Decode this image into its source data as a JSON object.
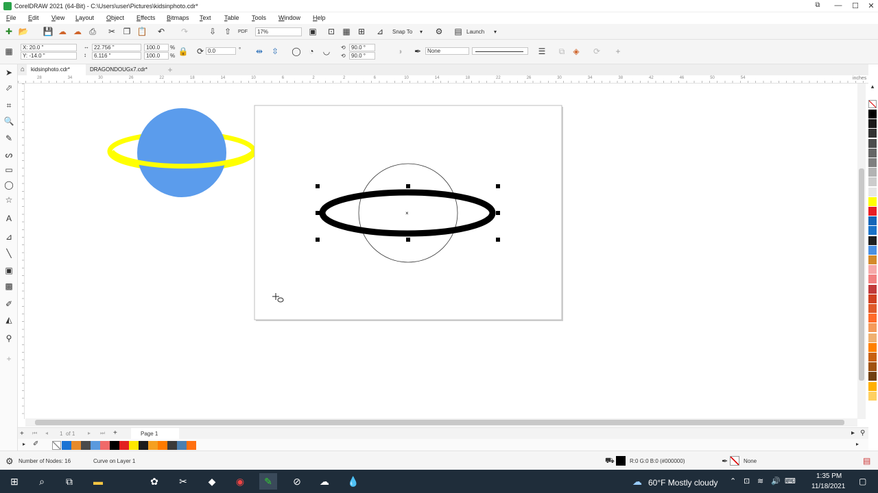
{
  "window": {
    "title": "CorelDRAW 2021 (64-Bit) - C:\\Users\\user\\Pictures\\kidsinphoto.cdr*",
    "minimize": "—",
    "maximize": "☐",
    "close": "✕"
  },
  "menu": [
    "File",
    "Edit",
    "View",
    "Layout",
    "Object",
    "Effects",
    "Bitmaps",
    "Text",
    "Table",
    "Tools",
    "Window",
    "Help"
  ],
  "standard_toolbar": {
    "zoom": "17%",
    "snap_to": "Snap To",
    "launch": "Launch"
  },
  "property_bar": {
    "x": "X: 20.0 \"",
    "y": "Y: -14.0 \"",
    "width": "22.756 \"",
    "height": "6.116 \"",
    "scale_w": "100.0",
    "scale_h": "100.0",
    "pct": "%",
    "rotation": "0.0",
    "angle1": "90.0 °",
    "angle2": "90.0 °",
    "outline_none": "None"
  },
  "tabs": [
    "kidsinphoto.cdr*",
    "DRAGONDOUGx7.cdr*"
  ],
  "ruler": {
    "top": [
      "28",
      "34",
      "30",
      "26",
      "22",
      "18",
      "14",
      "10",
      "6",
      "2",
      "2",
      "6",
      "10",
      "14",
      "18",
      "22",
      "26",
      "30",
      "34",
      "38",
      "42",
      "46",
      "50",
      "54"
    ],
    "unit": "inches"
  },
  "page_nav": {
    "current": "1",
    "of": "of 1",
    "page_tab": "Page 1"
  },
  "doc_palette": [
    "#1a73d4",
    "#e78a2b",
    "#4a4a4a",
    "#5a9ade",
    "#f06a6a",
    "#000000",
    "#e22020",
    "#ffe800",
    "#1c1c1c",
    "#f5a020",
    "#ff7b00",
    "#3a3a3a",
    "#4a7fb0",
    "#ff7010"
  ],
  "side_palette": [
    "#000000",
    "#1a1a1a",
    "#333333",
    "#4d4d4d",
    "#666666",
    "#808080",
    "#b3b3b3",
    "#cccccc",
    "#e6e6e6",
    "#ffff00",
    "#e81e25",
    "#1465b8",
    "#1a72c8",
    "#202020",
    "#4a90e2",
    "#d48a2a",
    "#f7a8a8",
    "#f28080",
    "#c23a3a",
    "#d04020",
    "#e05a2a",
    "#ff6b2a",
    "#f59a5a",
    "#f0b070",
    "#ff8000",
    "#c86010",
    "#a0520f",
    "#704010",
    "#ffb000",
    "#ffd060"
  ],
  "status": {
    "nodes": "Number of Nodes: 16",
    "layer": "Curve on Layer 1",
    "fill": "R:0 G:0 B:0 (#000000)",
    "outline": "None"
  },
  "taskbar": {
    "weather": "60°F  Mostly cloudy",
    "time": "1:35 PM",
    "date": "11/18/2021"
  },
  "colors": {
    "planet": "#5b9cec",
    "ring": "#ffff00",
    "ellipse_stroke": "#000000"
  }
}
